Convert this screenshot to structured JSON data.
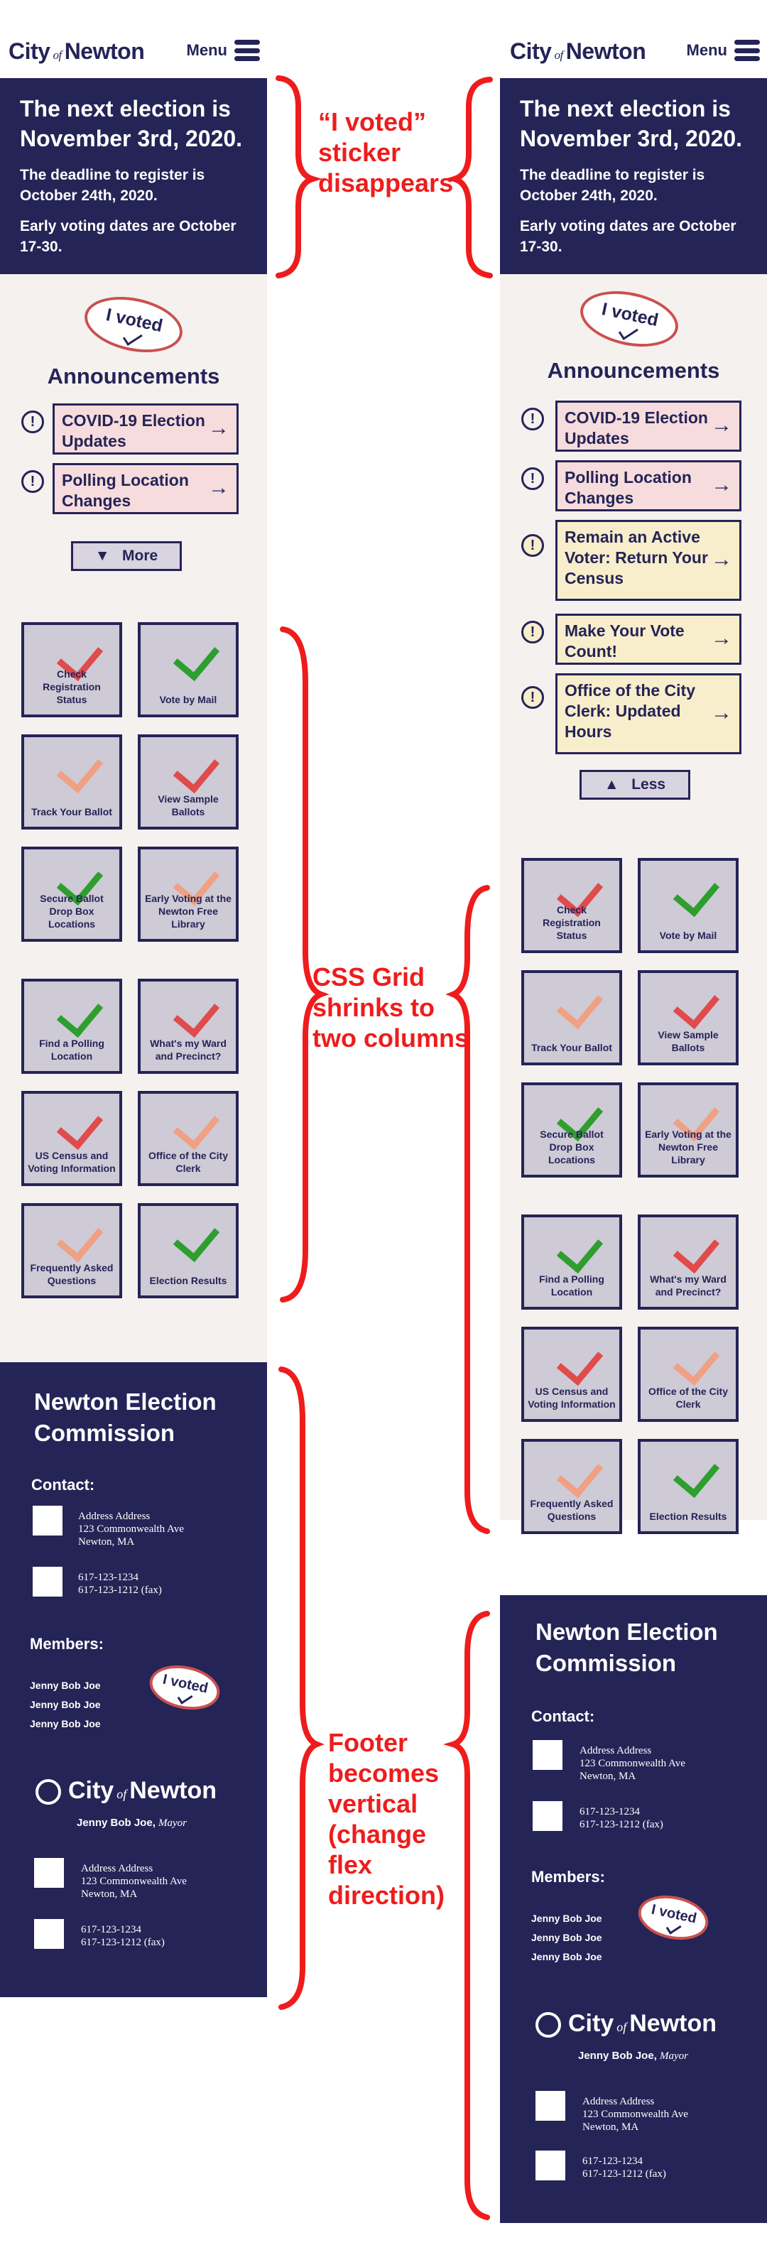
{
  "header": {
    "logo_left": "City",
    "logo_of": "of",
    "logo_right": "Newton",
    "menu_label": "Menu"
  },
  "hero": {
    "title": "The next election is November 3rd, 2020.",
    "deadline": "The deadline to register is October 24th, 2020.",
    "early_voting": "Early voting dates are October 17-30."
  },
  "sticker": {
    "text": "I voted"
  },
  "announcements": {
    "title": "Announcements",
    "items": [
      {
        "label": "COVID-19 Election Updates",
        "arrow": "→"
      },
      {
        "label": "Polling Location Changes",
        "arrow": "→"
      },
      {
        "label": "Remain an Active Voter: Return Your Census",
        "arrow": "→"
      },
      {
        "label": "Make Your Vote Count!",
        "arrow": "→"
      },
      {
        "label": "Office of the City Clerk: Updated Hours",
        "arrow": "→"
      }
    ],
    "bang": "!",
    "more_label": "More",
    "less_label": "Less"
  },
  "tiles": [
    {
      "label": "Check Registration Status",
      "check_color": "#e04b4b"
    },
    {
      "label": "Vote by Mail",
      "check_color": "#2e9e2e"
    },
    {
      "label": "Track Your Ballot",
      "check_color": "#f0a083"
    },
    {
      "label": "View Sample Ballots",
      "check_color": "#e04b4b"
    },
    {
      "label": "Secure Ballot Drop Box Locations",
      "check_color": "#2e9e2e"
    },
    {
      "label": "Early Voting at the Newton Free Library",
      "check_color": "#f0a083"
    },
    {
      "label": "Find a Polling Location",
      "check_color": "#2e9e2e"
    },
    {
      "label": "What's my Ward and Precinct?",
      "check_color": "#e04b4b"
    },
    {
      "label": "US Census and Voting Information",
      "check_color": "#e04b4b"
    },
    {
      "label": "Office of the City Clerk",
      "check_color": "#f0a083"
    },
    {
      "label": "Frequently Asked Questions",
      "check_color": "#f0a083"
    },
    {
      "label": "Election Results",
      "check_color": "#2e9e2e"
    }
  ],
  "footer": {
    "title": "Newton Election Commission",
    "contact_label": "Contact:",
    "address_lines": [
      "Address Address",
      "123 Commonwealth Ave",
      "Newton, MA"
    ],
    "phone_lines": [
      "617-123-1234",
      "617-123-1212 (fax)"
    ],
    "members_label": "Members:",
    "members": [
      "Jenny Bob Joe",
      "Jenny Bob Joe",
      "Jenny Bob Joe"
    ],
    "mayor_name": "Jenny Bob Joe,",
    "mayor_title": "Mayor"
  },
  "annotations": [
    "“I voted” sticker disappears",
    "CSS Grid shrinks to two columns",
    "Footer becomes vertical (change flex direction)"
  ],
  "colors": {
    "navy": "#252457",
    "annotation_red": "#ee1c1c",
    "pink": "#f6dcdc",
    "yellow": "#f8eecb",
    "tile": "#cecad6",
    "page": "#f5f1ef"
  }
}
